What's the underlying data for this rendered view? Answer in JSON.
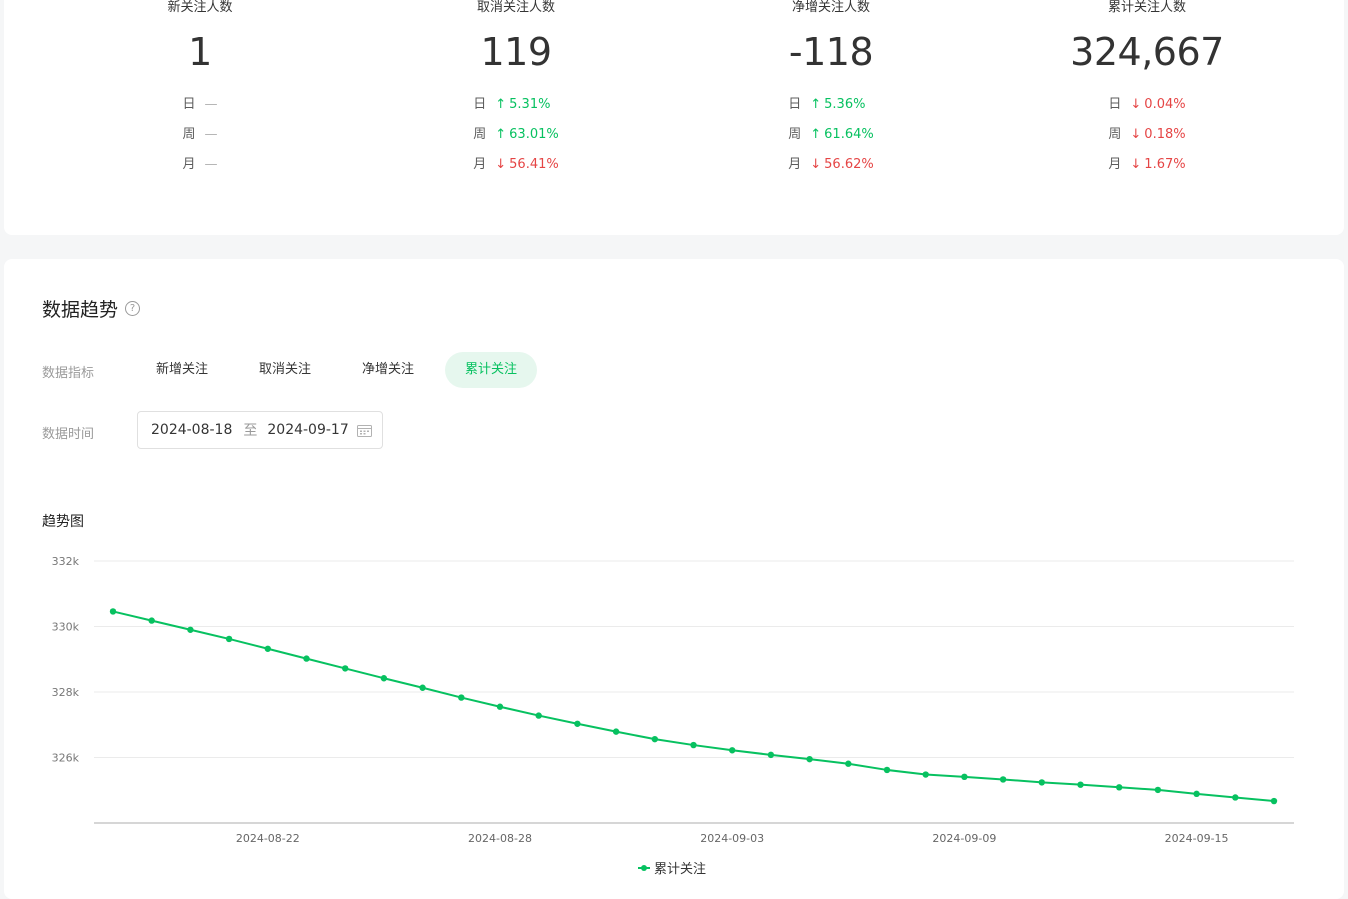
{
  "stats": [
    {
      "title": "新关注人数",
      "value": "1",
      "rows": [
        {
          "label": "日",
          "dir": "none",
          "arrow": "",
          "text": "—"
        },
        {
          "label": "周",
          "dir": "none",
          "arrow": "",
          "text": "—"
        },
        {
          "label": "月",
          "dir": "none",
          "arrow": "",
          "text": "—"
        }
      ]
    },
    {
      "title": "取消关注人数",
      "value": "119",
      "rows": [
        {
          "label": "日",
          "dir": "up",
          "arrow": "↑",
          "text": "5.31%"
        },
        {
          "label": "周",
          "dir": "up",
          "arrow": "↑",
          "text": "63.01%"
        },
        {
          "label": "月",
          "dir": "down",
          "arrow": "↓",
          "text": "56.41%"
        }
      ]
    },
    {
      "title": "净增关注人数",
      "value": "-118",
      "rows": [
        {
          "label": "日",
          "dir": "up",
          "arrow": "↑",
          "text": "5.36%"
        },
        {
          "label": "周",
          "dir": "up",
          "arrow": "↑",
          "text": "61.64%"
        },
        {
          "label": "月",
          "dir": "down",
          "arrow": "↓",
          "text": "56.62%"
        }
      ]
    },
    {
      "title": "累计关注人数",
      "value": "324,667",
      "rows": [
        {
          "label": "日",
          "dir": "down",
          "arrow": "↓",
          "text": "0.04%"
        },
        {
          "label": "周",
          "dir": "down",
          "arrow": "↓",
          "text": "0.18%"
        },
        {
          "label": "月",
          "dir": "down",
          "arrow": "↓",
          "text": "1.67%"
        }
      ]
    }
  ],
  "trend": {
    "title": "数据趋势",
    "help_icon": "?",
    "metric_label": "数据指标",
    "metrics": [
      "新增关注",
      "取消关注",
      "净增关注",
      "累计关注"
    ],
    "active_metric": "累计关注",
    "time_label": "数据时间",
    "date_start": "2024-08-18",
    "date_sep": "至",
    "date_end": "2024-09-17",
    "chart_title": "趋势图"
  },
  "colors": {
    "accent": "#07c160",
    "down": "#e54545",
    "tab_active_bg": "#e6f7ee"
  },
  "chart_data": {
    "type": "line",
    "ylim": [
      324000,
      332000
    ],
    "yticks": [
      326000,
      328000,
      330000,
      332000
    ],
    "ytick_labels": [
      "326k",
      "328k",
      "330k",
      "332k"
    ],
    "xtick_labels": [
      "2024-08-22",
      "2024-08-28",
      "2024-09-03",
      "2024-09-09",
      "2024-09-15"
    ],
    "xtick_indices": [
      4,
      10,
      16,
      22,
      28
    ],
    "legend_position": "bottom-center",
    "series": [
      {
        "name": "累计关注",
        "color": "#07c160",
        "values": [
          330460,
          330180,
          329900,
          329620,
          329320,
          329020,
          328720,
          328420,
          328130,
          327830,
          327550,
          327280,
          327030,
          326790,
          326560,
          326380,
          326220,
          326080,
          325950,
          325810,
          325620,
          325480,
          325410,
          325330,
          325240,
          325170,
          325090,
          325010,
          324890,
          324780,
          324670
        ]
      }
    ]
  }
}
